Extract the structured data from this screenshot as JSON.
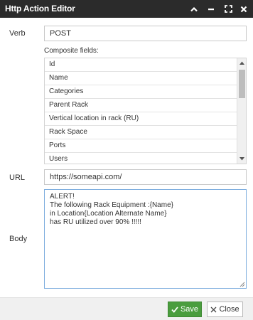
{
  "window": {
    "title": "Http Action Editor",
    "controls": [
      "chevron-up-icon",
      "minimize-icon",
      "expand-icon",
      "close-icon"
    ]
  },
  "form": {
    "verb_label": "Verb",
    "verb_value": "POST",
    "composite_title": "Composite fields:",
    "composite_items": [
      "Id",
      "Name",
      "Categories",
      "Parent Rack",
      "Vertical location in rack (RU)",
      "Rack Space",
      "Ports",
      "Users"
    ],
    "url_label": "URL",
    "url_value": "https://someapi.com/",
    "body_label": "Body",
    "body_lines": [
      "ALERT!",
      "The following Rack Equipment :{Name}",
      "in Location{Location Alternate Name}",
      "has RU utilized over 90% !!!!!"
    ]
  },
  "footer": {
    "save_label": "Save",
    "close_label": "Close"
  },
  "colors": {
    "titlebar": "#2b2b2b",
    "save_button": "#4a9d3e",
    "footer": "#f0f0f0",
    "focus_border": "#7eaede"
  }
}
